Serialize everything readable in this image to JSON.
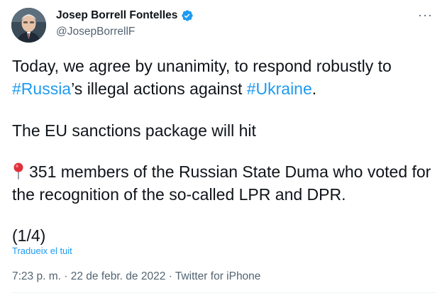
{
  "author": {
    "name": "Josep Borrell Fontelles",
    "handle": "@JosepBorrellF",
    "verified": true
  },
  "tweet": {
    "line1_part1": "Today, we agree by unanimity, to respond robustly to ",
    "hashtag1": "#Russia",
    "line1_part2": "’s illegal actions against ",
    "hashtag2": "#Ukraine",
    "line1_part3": ".",
    "paragraph2": "The EU sanctions package will hit",
    "paragraph3": "351 members of the Russian State Duma who voted for the recognition of the so-called LPR and DPR.",
    "paragraph4": "(1/4)"
  },
  "translate_label": "Tradueix el tuit",
  "meta": {
    "time": "7:23 p. m.",
    "separator1": " · ",
    "date": "22 de febr. de 2022",
    "separator2": " · ",
    "source": "Twitter for iPhone"
  },
  "icons": {
    "more": "more-options-icon",
    "verified": "verified-badge-icon",
    "pin": "round-pushpin-icon"
  },
  "colors": {
    "link": "#1d9bf0",
    "secondary_text": "#536471",
    "primary_text": "#0f1419"
  }
}
